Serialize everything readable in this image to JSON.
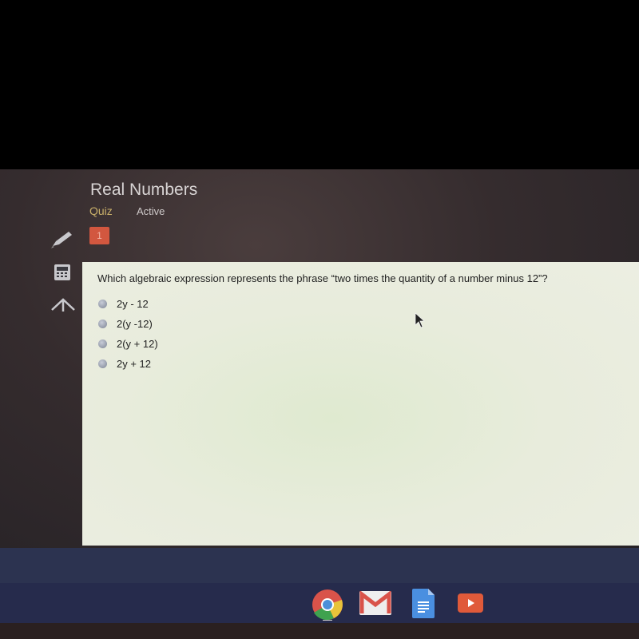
{
  "header": {
    "title": "Real Numbers",
    "tabs": [
      {
        "label": "Quiz"
      },
      {
        "label": "Active"
      }
    ]
  },
  "question_nav": {
    "current": "1"
  },
  "question": {
    "text": "Which algebraic expression represents the phrase “two times the quantity of a number minus 12”?",
    "options": [
      {
        "label": "2y - 12"
      },
      {
        "label": "2(y -12)"
      },
      {
        "label": "2(y + 12)"
      },
      {
        "label": "2y + 12"
      }
    ]
  },
  "sidebar_tools": [
    "pencil-icon",
    "calculator-icon",
    "arrow-up-icon"
  ],
  "shelf": [
    "chrome-icon",
    "gmail-icon",
    "docs-icon",
    "youtube-icon"
  ],
  "colors": {
    "accent": "#d2573f",
    "quiz_tab": "#c9b06a",
    "panel": "#e8ecdc"
  }
}
